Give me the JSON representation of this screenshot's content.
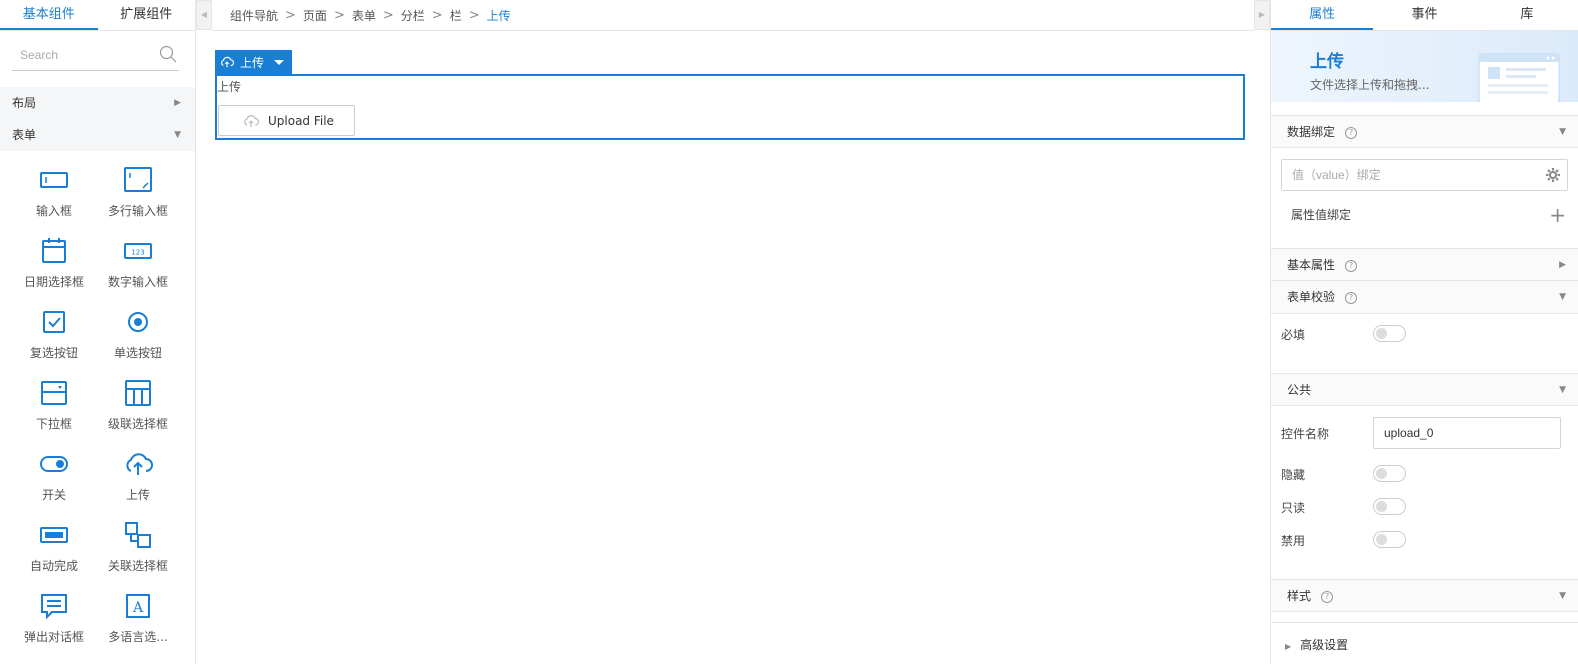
{
  "left_panel": {
    "tabs": [
      {
        "label": "基本组件",
        "active": true
      },
      {
        "label": "扩展组件",
        "active": false
      }
    ],
    "search_placeholder": "Search",
    "groups": [
      {
        "label": "布局",
        "expanded": false
      },
      {
        "label": "表单",
        "expanded": true
      }
    ],
    "components": [
      {
        "label": "输入框",
        "icon": "input-icon"
      },
      {
        "label": "多行输入框",
        "icon": "textarea-icon"
      },
      {
        "label": "日期选择框",
        "icon": "calendar-icon"
      },
      {
        "label": "数字输入框",
        "icon": "number-input-icon"
      },
      {
        "label": "复选按钮",
        "icon": "checkbox-icon"
      },
      {
        "label": "单选按钮",
        "icon": "radio-icon"
      },
      {
        "label": "下拉框",
        "icon": "select-icon"
      },
      {
        "label": "级联选择框",
        "icon": "cascader-icon"
      },
      {
        "label": "开关",
        "icon": "switch-icon"
      },
      {
        "label": "上传",
        "icon": "cloud-upload-icon"
      },
      {
        "label": "自动完成",
        "icon": "autocomplete-icon"
      },
      {
        "label": "关联选择框",
        "icon": "relation-select-icon"
      },
      {
        "label": "弹出对话框",
        "icon": "dialog-icon"
      },
      {
        "label": "多语言选...",
        "icon": "multilang-icon"
      }
    ]
  },
  "breadcrumb": [
    "组件导航",
    "页面",
    "表单",
    "分栏",
    "栏",
    "上传"
  ],
  "canvas": {
    "selected_tag": "上传",
    "upload_label": "上传",
    "upload_button": "Upload File"
  },
  "right_panel": {
    "tabs": [
      {
        "label": "属性",
        "active": true
      },
      {
        "label": "事件",
        "active": false
      },
      {
        "label": "库",
        "active": false
      }
    ],
    "hero": {
      "title": "上传",
      "desc": "文件选择上传和拖拽..."
    },
    "sections": {
      "data_binding": "数据绑定",
      "value_placeholder": "值（value）绑定",
      "prop_binding": "属性值绑定",
      "basic": "基本属性",
      "validation": "表单校验",
      "required": "必填",
      "common": "公共",
      "control_name_label": "控件名称",
      "control_name_value": "upload_0",
      "hidden": "隐藏",
      "readonly": "只读",
      "disabled": "禁用",
      "style": "样式",
      "advanced": "高级设置"
    }
  },
  "colors": {
    "accent": "#1a7fd4",
    "border": "#e6e6e6"
  }
}
